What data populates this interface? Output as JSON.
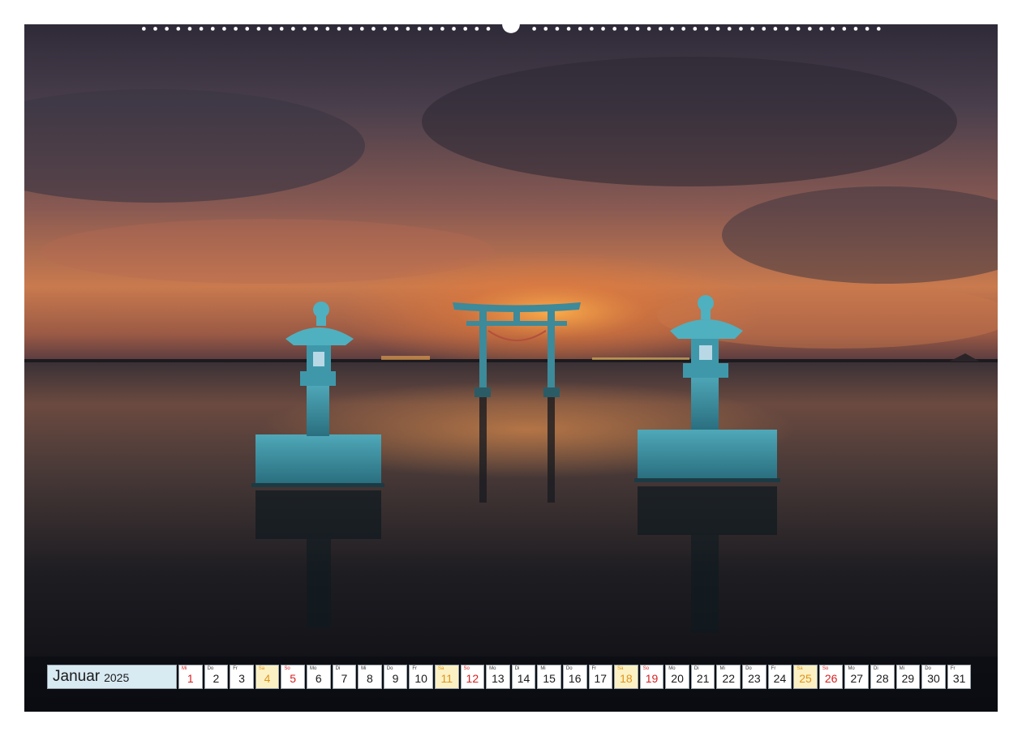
{
  "calendar": {
    "month": "Januar",
    "year": "2025",
    "days": [
      {
        "wd": "Mi",
        "d": "1",
        "type": "hol"
      },
      {
        "wd": "Do",
        "d": "2",
        "type": "wk"
      },
      {
        "wd": "Fr",
        "d": "3",
        "type": "wk"
      },
      {
        "wd": "Sa",
        "d": "4",
        "type": "sat"
      },
      {
        "wd": "So",
        "d": "5",
        "type": "sun"
      },
      {
        "wd": "Mo",
        "d": "6",
        "type": "wk"
      },
      {
        "wd": "Di",
        "d": "7",
        "type": "wk"
      },
      {
        "wd": "Mi",
        "d": "8",
        "type": "wk"
      },
      {
        "wd": "Do",
        "d": "9",
        "type": "wk"
      },
      {
        "wd": "Fr",
        "d": "10",
        "type": "wk"
      },
      {
        "wd": "Sa",
        "d": "11",
        "type": "sat"
      },
      {
        "wd": "So",
        "d": "12",
        "type": "sun"
      },
      {
        "wd": "Mo",
        "d": "13",
        "type": "wk"
      },
      {
        "wd": "Di",
        "d": "14",
        "type": "wk"
      },
      {
        "wd": "Mi",
        "d": "15",
        "type": "wk"
      },
      {
        "wd": "Do",
        "d": "16",
        "type": "wk"
      },
      {
        "wd": "Fr",
        "d": "17",
        "type": "wk"
      },
      {
        "wd": "Sa",
        "d": "18",
        "type": "sat"
      },
      {
        "wd": "So",
        "d": "19",
        "type": "sun"
      },
      {
        "wd": "Mo",
        "d": "20",
        "type": "wk"
      },
      {
        "wd": "Di",
        "d": "21",
        "type": "wk"
      },
      {
        "wd": "Mi",
        "d": "22",
        "type": "wk"
      },
      {
        "wd": "Do",
        "d": "23",
        "type": "wk"
      },
      {
        "wd": "Fr",
        "d": "24",
        "type": "wk"
      },
      {
        "wd": "Sa",
        "d": "25",
        "type": "sat"
      },
      {
        "wd": "So",
        "d": "26",
        "type": "sun"
      },
      {
        "wd": "Mo",
        "d": "27",
        "type": "wk"
      },
      {
        "wd": "Di",
        "d": "28",
        "type": "wk"
      },
      {
        "wd": "Mi",
        "d": "29",
        "type": "wk"
      },
      {
        "wd": "Do",
        "d": "30",
        "type": "wk"
      },
      {
        "wd": "Fr",
        "d": "31",
        "type": "wk"
      }
    ]
  },
  "colors": {
    "sunday": "#d61f1f",
    "saturday": "#e0941a",
    "saturday_bg": "#fbf1c4",
    "month_bg": "#d8eaf2"
  }
}
